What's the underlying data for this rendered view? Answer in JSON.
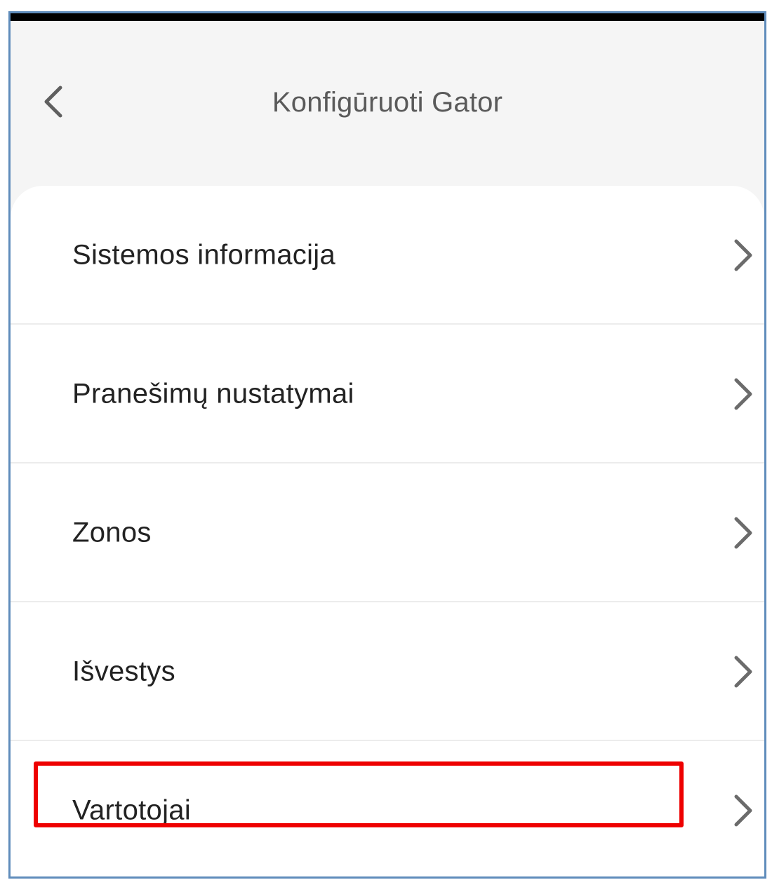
{
  "header": {
    "title": "Konfigūruoti Gator",
    "back_icon": "chevron-left-icon"
  },
  "menu": {
    "items": [
      {
        "label": "Sistemos informacija",
        "icon": "chevron-right-icon"
      },
      {
        "label": "Pranešimų nustatymai",
        "icon": "chevron-right-icon"
      },
      {
        "label": "Zonos",
        "icon": "chevron-right-icon"
      },
      {
        "label": "Išvestys",
        "icon": "chevron-right-icon"
      },
      {
        "label": "Vartotojai",
        "icon": "chevron-right-icon",
        "highlighted": true
      }
    ]
  },
  "colors": {
    "header_bg": "#f5f5f5",
    "card_bg": "#ffffff",
    "title_text": "#5a5a5a",
    "item_text": "#222222",
    "chevron": "#6b6b6b",
    "highlight": "#ee0000",
    "frame_border": "#5f8cbb"
  }
}
